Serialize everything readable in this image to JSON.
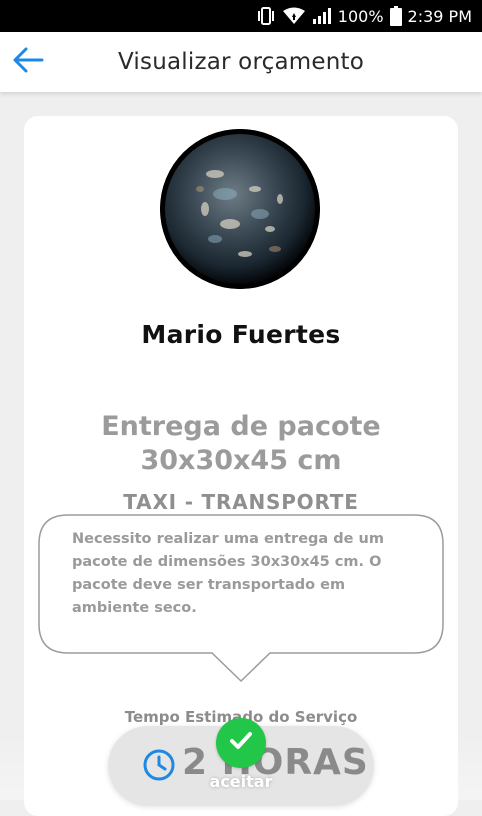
{
  "status_bar": {
    "battery": "100%",
    "time": "2:39 PM",
    "icons": [
      "vibrate-icon",
      "wifi-icon",
      "signal-icon",
      "battery-icon"
    ]
  },
  "app_bar": {
    "back_icon": "arrow-left-icon",
    "title": "Visualizar orçamento"
  },
  "profile": {
    "name": "Mario Fuertes"
  },
  "service": {
    "title": "Entrega de pacote 30x30x45 cm",
    "category": "TAXI - TRANSPORTE",
    "description": "Necessito realizar uma entrega de um pacote de dimensões 30x30x45 cm. O pacote deve ser transportado em ambiente seco."
  },
  "estimate": {
    "label": "Tempo Estimado do Serviço",
    "value": "2 HORAS",
    "icon": "clock-icon"
  },
  "accept": {
    "icon": "check-icon",
    "label": "aceitar"
  },
  "colors": {
    "accent": "#1e88e5",
    "accept_green": "#22c74a",
    "muted_text": "#9b9b9b"
  }
}
